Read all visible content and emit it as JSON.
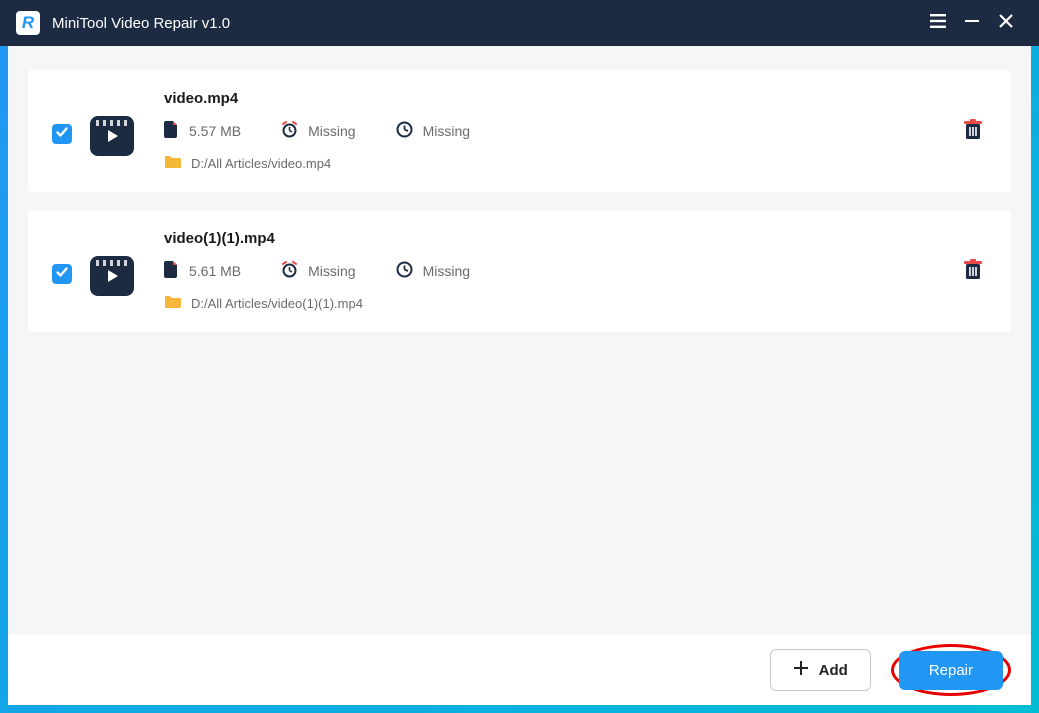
{
  "titlebar": {
    "logo_letter": "R",
    "title": "MiniTool Video Repair v1.0"
  },
  "files": [
    {
      "name": "video.mp4",
      "size": "5.57 MB",
      "duration": "Missing",
      "date": "Missing",
      "path": "D:/All Articles/video.mp4"
    },
    {
      "name": "video(1)(1).mp4",
      "size": "5.61 MB",
      "duration": "Missing",
      "date": "Missing",
      "path": "D:/All Articles/video(1)(1).mp4"
    }
  ],
  "buttons": {
    "add": "Add",
    "repair": "Repair"
  }
}
